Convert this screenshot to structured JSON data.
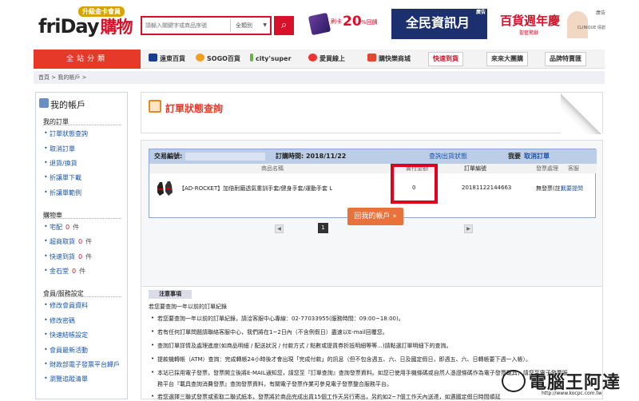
{
  "header": {
    "logo": "friDay",
    "logo_cn": "購物",
    "badge": "升級金卡會員",
    "search_placeholder": "請輸入關鍵字或商品序號",
    "search_category": "全類別",
    "promo1_small": "刷卡",
    "promo1_big": "20",
    "promo1_suffix": "%回饋",
    "promo2_text": "全民資訊月",
    "promo2_tag": "廣告",
    "promo3_text": "百貨週年慶",
    "promo3_sub": "聖藝驚獻",
    "promo3_tag": "廣告",
    "promo3_brand": "CLINIQUE 倩碧"
  },
  "nav": {
    "category": "全站分類",
    "items": [
      "遠東百貨",
      "SOGO百貨",
      "city'super",
      "愛買線上",
      "購快樂商城"
    ],
    "buttons": [
      "快速到貨",
      "來來大團購",
      "品牌特賣匯"
    ]
  },
  "breadcrumb": {
    "home": "首頁",
    "sep": ">",
    "current": "我的帳戶",
    "sep2": ">"
  },
  "sidebar": {
    "title": "我的帳戶",
    "sections": {
      "orders": "我的訂單",
      "cart": "購物車",
      "member": "會員/服務設定"
    },
    "order_items": [
      "訂單狀態查詢",
      "取消訂單",
      "退貨/換貨",
      "折讓單下載",
      "折讓單範例"
    ],
    "cart_items": [
      {
        "label": "宅配",
        "count": "0",
        "unit": "件"
      },
      {
        "label": "超商取貨",
        "count": "0",
        "unit": "件"
      },
      {
        "label": "快速到貨",
        "count": "0",
        "unit": "件"
      },
      {
        "label": "金石堂",
        "count": "0",
        "unit": "件"
      }
    ],
    "member_items": [
      "修改會員資料",
      "修改密碼",
      "快速結帳設定",
      "會員最新活動",
      "財政部電子發票平台歸戶",
      "瀏覽追蹤清單"
    ]
  },
  "page": {
    "title": "訂單狀態查詢",
    "order": {
      "no_label": "交易編號:",
      "time_label": "訂購時間: 2018/11/22",
      "ship_link": "查詢出貨狀態",
      "cancel_label": "我要",
      "cancel_link": "取消訂單",
      "col_name": "商品名稱",
      "col_amount": "實付金額",
      "col_order_no": "訂單編號",
      "col_invoice": "發票處理",
      "col_service": "客服",
      "item_name": "【AD-ROCKET】加倍耐磨透氣重訓手套/健身手套/運動手套 L",
      "amount": "0",
      "order_no": "20181122144663",
      "invoice": "無發票(註)",
      "service_link": "我要提問"
    },
    "pager": {
      "prev": "◀",
      "current": "1",
      "next": "▶"
    },
    "back_button": "回我的帳戶 »"
  },
  "notes": {
    "title": "注意事項",
    "intro": "若您要查詢一年以前的訂單紀錄",
    "lines": [
      "若您要查詢一年以前的訂單紀錄，請洽客服中心專線：02-77033955(服務時間：09:00~18:00)。",
      "若有任何訂單問題請聯絡客服中心，我們將在1~2日內（不含例假日）盡速以E-mail回覆您。",
      "查詢訂單詳情及處理進度(如商品明細 / 配送狀況 / 付款方式 / 點數或提貨券折抵明細等等...)請點選訂單明細下的查詢。",
      "提款機轉帳（ATM）查詢：完成轉帳24小時後才會出現「完成付款」的訊息（但不包含週五、六、日及國定假日，即週五、六、日轉帳要下週一入帳）。",
      "本站已採用電子發票，發票開立後將E-MAIL通知您，請您至『訂單查詢』查詢發票資料。如您已使用手機條碼或自然人憑證條碼作為電子發票載具，請您至電子發票服",
      "務平台『載具查詢消費發票』查詢發票資料，有關電子發票作業可參見電子發票整合服務平台。",
      "若您選擇三聯式發票或索取二聯式紙本，發票將於商品完成出貨15個工作天另行寄出，另約如2~7個工作天內送達，如遇國定假日時間順延"
    ],
    "bottom": "會員/服務設定"
  },
  "watermark": {
    "text": "電腦王阿達",
    "url": "http://www.kocpc.com.tw"
  }
}
